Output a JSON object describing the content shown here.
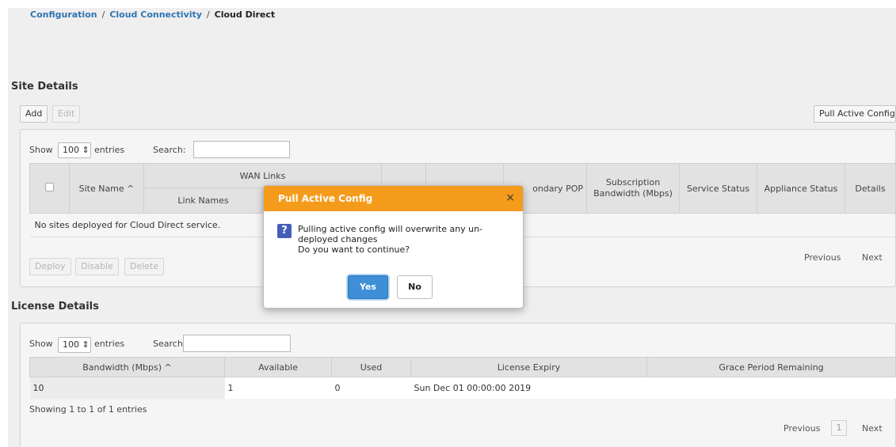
{
  "breadcrumb": {
    "items": [
      "Configuration",
      "Cloud Connectivity"
    ],
    "separator": "/",
    "current": "Cloud Direct"
  },
  "site_details": {
    "title": "Site Details",
    "add_label": "Add",
    "edit_label": "Edit",
    "pull_label": "Pull Active Config",
    "show_label": "Show",
    "entries_value": "100",
    "entries_label": "entries",
    "search_label": "Search:",
    "table": {
      "col_site_name": "Site Name",
      "col_wan_links": "WAN Links",
      "col_link_names": "Link Names",
      "col_secondary_pop": "ondary POP",
      "col_subscription": "Subscription Bandwidth (Mbps)",
      "col_service_status": "Service Status",
      "col_appliance_status": "Appliance Status",
      "col_details": "Details",
      "empty_message": "No sites deployed for Cloud Direct service."
    },
    "deploy_label": "Deploy",
    "disable_label": "Disable",
    "delete_label": "Delete",
    "previous_label": "Previous",
    "next_label": "Next"
  },
  "license_details": {
    "title": "License Details",
    "show_label": "Show",
    "entries_value": "100",
    "entries_label": "entries",
    "search_label": "Search:",
    "columns": [
      "Bandwidth (Mbps)",
      "Available",
      "Used",
      "License Expiry",
      "Grace Period Remaining"
    ],
    "rows": [
      [
        "10",
        "1",
        "0",
        "Sun Dec 01 00:00:00 2019",
        ""
      ]
    ],
    "showing": "Showing 1 to 1 of 1 entries",
    "previous_label": "Previous",
    "page": "1",
    "next_label": "Next"
  },
  "dialog": {
    "title": "Pull Active Config",
    "close_glyph": "×",
    "message_line1": "Pulling active config will overwrite any un-",
    "message_line2": "deployed changes",
    "message_line3": "Do you want to continue?",
    "yes_label": "Yes",
    "no_label": "No",
    "header_color": "#f59b1b",
    "primary_color": "#3e8fd8"
  }
}
